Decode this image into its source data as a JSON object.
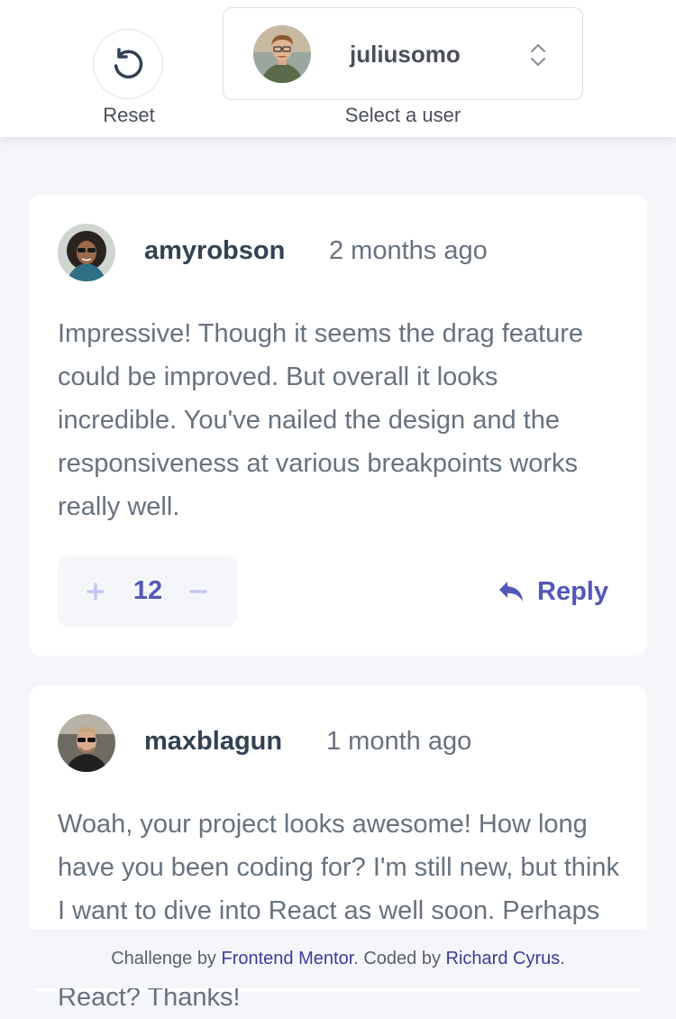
{
  "header": {
    "reset": {
      "label": "Reset",
      "icon": "reset-icon"
    },
    "user_select": {
      "selected_user": "juliusomo",
      "label": "Select a user",
      "icon": "chevron-updown-icon"
    }
  },
  "comments": [
    {
      "username": "amyrobson",
      "time": "2 months ago",
      "content": "Impressive! Though it seems the drag feature could be improved. But overall it looks incredible. You've nailed the design and the responsiveness at various breakpoints works really well.",
      "score": "12",
      "reply_label": "Reply"
    },
    {
      "username": "maxblagun",
      "time": "1 month ago",
      "content": "Woah, your project looks awesome! How long have you been coding for? I'm still new, but think I want to dive into React as well soon. Perhaps you can give me an insight on where I can learn React? Thanks!"
    }
  ],
  "footer": {
    "prefix": "Challenge by ",
    "link1": "Frontend Mentor",
    "middle": ". Coded by ",
    "link2": "Richard Cyrus",
    "suffix": "."
  },
  "colors": {
    "accent": "#5357b6",
    "text": "#334253",
    "muted": "#67727e",
    "background": "#f5f6fa"
  }
}
